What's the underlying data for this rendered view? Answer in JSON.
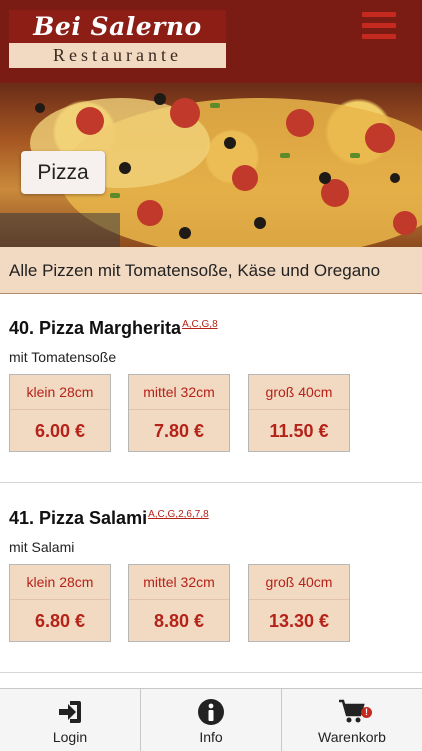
{
  "header": {
    "logo_top": "Bei Salerno",
    "logo_bottom": "Restaurante",
    "menu_icon": "hamburger-menu-icon"
  },
  "hero": {
    "category_label": "Pizza"
  },
  "banner": {
    "text": "Alle Pizzen mit Tomatensoße, Käse und Oregano"
  },
  "items": [
    {
      "title": "40. Pizza Margherita",
      "allergens": "A,C,G,8",
      "description": "mit Tomatensoße",
      "prices": [
        {
          "size": "klein 28cm",
          "price": "6.00 €"
        },
        {
          "size": "mittel 32cm",
          "price": "7.80 €"
        },
        {
          "size": "groß 40cm",
          "price": "11.50 €"
        }
      ]
    },
    {
      "title": "41. Pizza Salami",
      "allergens": "A,C,G,2,6,7,8",
      "description": "mit Salami",
      "prices": [
        {
          "size": "klein 28cm",
          "price": "6.80 €"
        },
        {
          "size": "mittel 32cm",
          "price": "8.80 €"
        },
        {
          "size": "groß 40cm",
          "price": "13.30 €"
        }
      ]
    }
  ],
  "tabbar": {
    "tabs": [
      {
        "label": "Login",
        "icon": "login-icon"
      },
      {
        "label": "Info",
        "icon": "info-icon"
      },
      {
        "label": "Warenkorb",
        "icon": "shopping-cart-icon",
        "badge": "!"
      }
    ]
  },
  "colors": {
    "header": "#7a1c14",
    "accent": "#b52218",
    "beige": "#f2d9c2"
  }
}
